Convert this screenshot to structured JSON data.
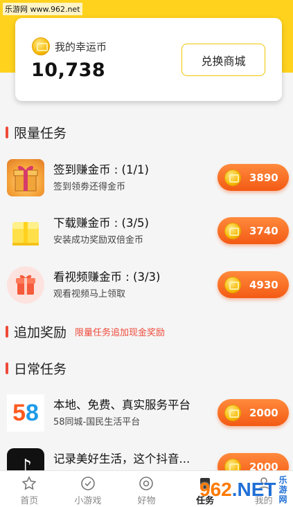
{
  "watermark": {
    "top": "乐游网 www.962.net",
    "logo_a": "962",
    "logo_b": ".NET",
    "site": "乐游网"
  },
  "wallet": {
    "label": "我的幸运币",
    "amount": "10,738",
    "exchange_label": "兑换商城"
  },
  "limited": {
    "title": "限量任务",
    "tasks": [
      {
        "title": "签到赚金币 : (1/1)",
        "subtitle": "签到领劵还得金币",
        "reward": "3890",
        "icon": "gift-box-icon"
      },
      {
        "title": "下载赚金币 : (3/5)",
        "subtitle": "安装成功奖励双倍金币",
        "reward": "3740",
        "icon": "yellow-gift-icon"
      },
      {
        "title": "看视频赚金币 : (3/3)",
        "subtitle": "观看视频马上领取",
        "reward": "4930",
        "icon": "red-gift-icon"
      }
    ]
  },
  "bonus": {
    "title": "追加奖励",
    "note": "限量任务追加现金奖励"
  },
  "daily": {
    "title": "日常任务",
    "tasks": [
      {
        "title": "本地、免费、真实服务平台",
        "subtitle": "58同城-国民生活平台",
        "reward": "2000",
        "icon": "58-app-icon"
      },
      {
        "title": "记录美好生活，这个抖音...",
        "subtitle": "",
        "reward": "2000",
        "icon": "tiktok-app-icon"
      }
    ]
  },
  "tabs": [
    {
      "label": "首页",
      "icon": "star-icon"
    },
    {
      "label": "小游戏",
      "icon": "check-circle-icon"
    },
    {
      "label": "好物",
      "icon": "target-icon"
    },
    {
      "label": "任务",
      "icon": "task-icon"
    },
    {
      "label": "我的",
      "icon": "user-icon"
    }
  ],
  "colors": {
    "accent_yellow": "#ffd21d",
    "reward_orange": "#f35a14",
    "section_red": "#ef4a3a"
  }
}
